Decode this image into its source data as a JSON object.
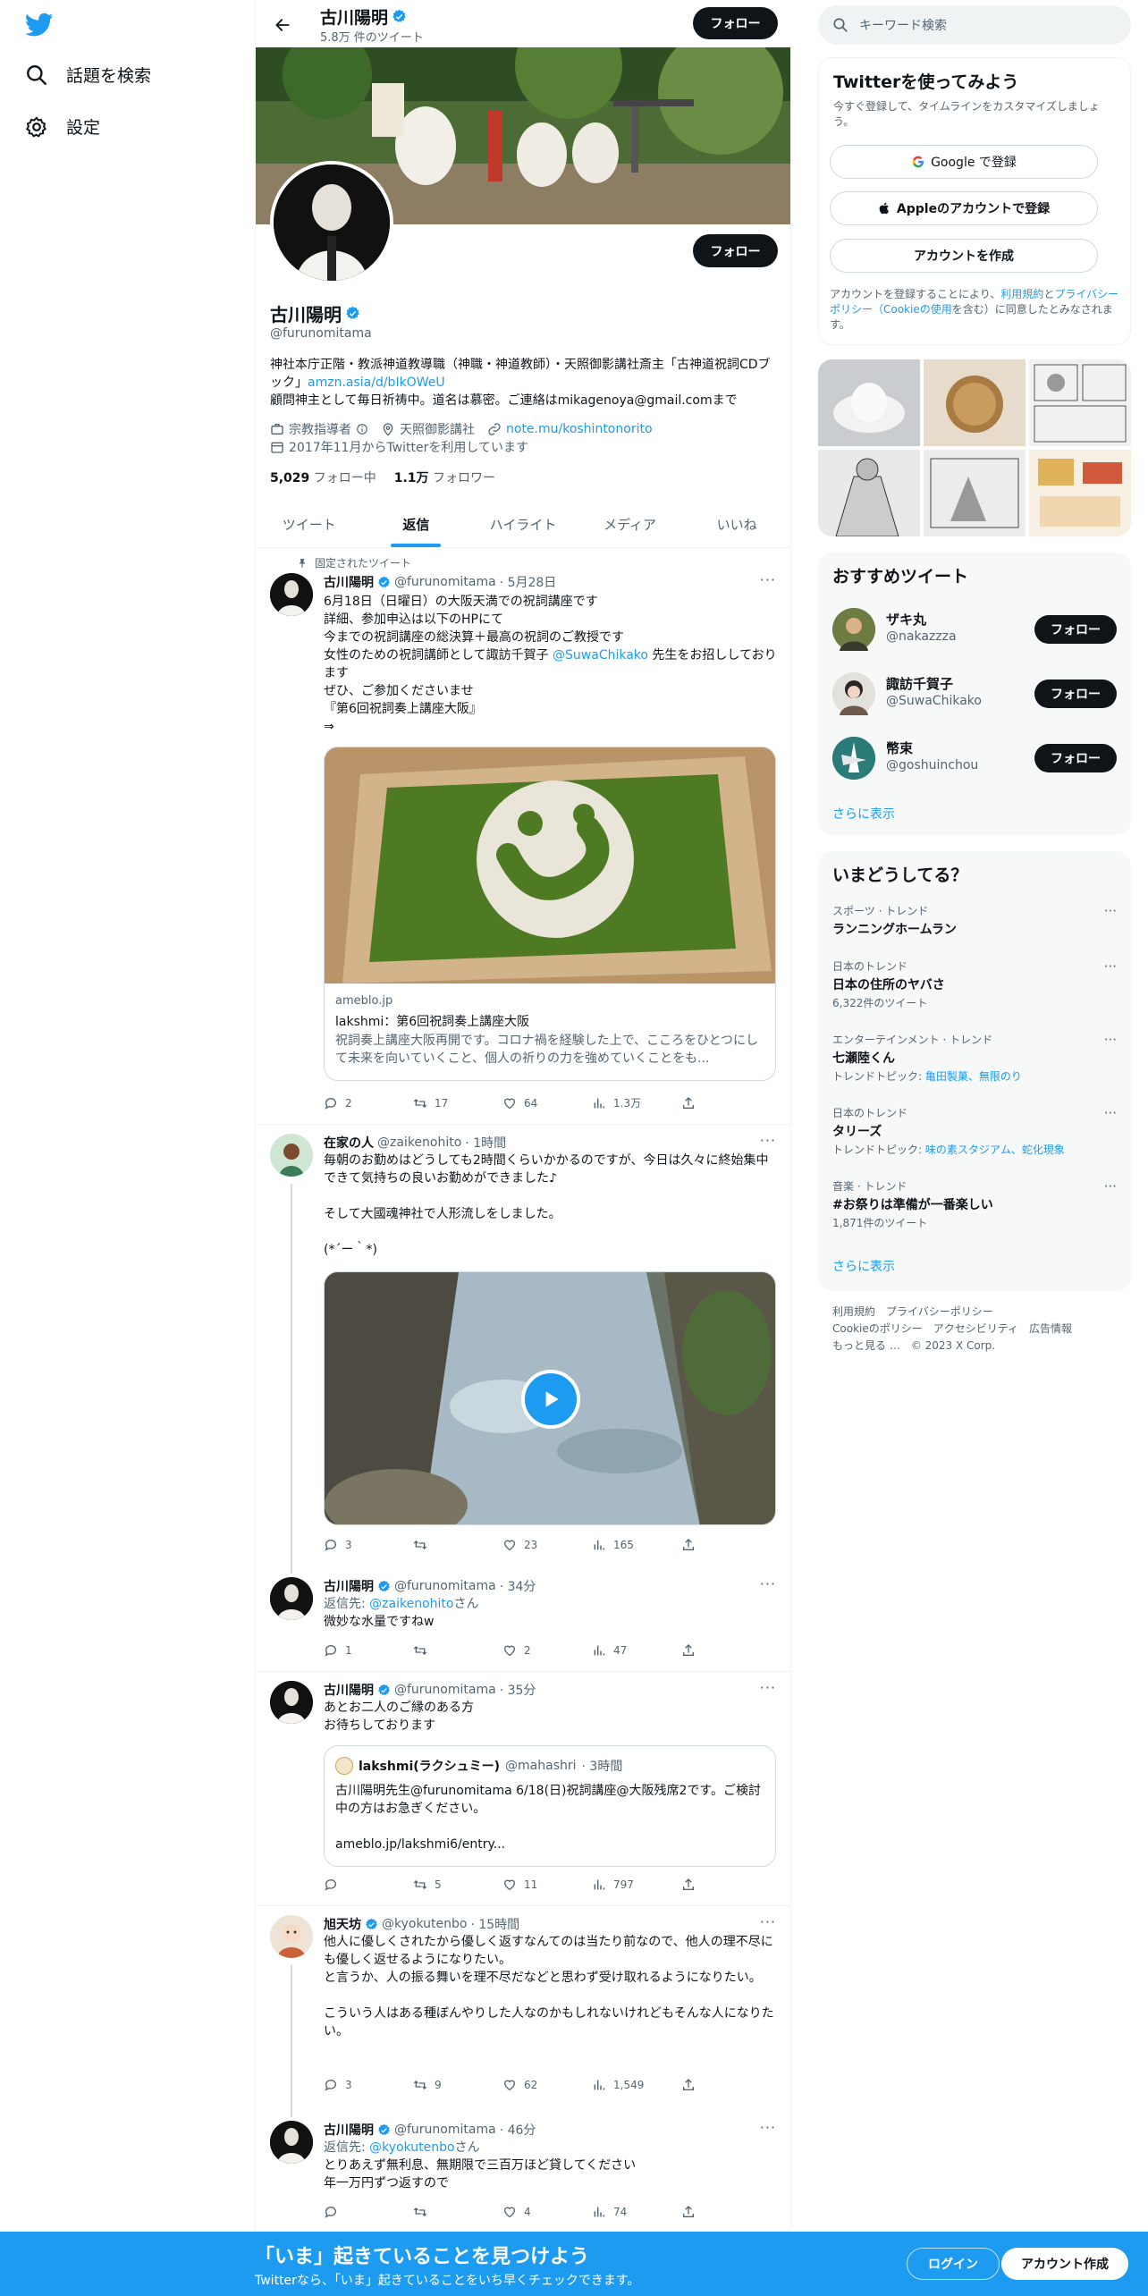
{
  "nav": {
    "explore": "話題を検索",
    "settings": "設定"
  },
  "header": {
    "name": "古川陽明",
    "tweet_count": "5.8万 件のツイート",
    "follow_label": "フォロー"
  },
  "profile": {
    "name": "古川陽明",
    "handle": "@furunomitama",
    "follow_label": "フォロー",
    "bio_line1": "神社本庁正階・教派神道教導職（神職・神道教師）・天照御影講社斎主「古神道祝詞CDブック」",
    "bio_link": "amzn.asia/d/bIkOWeU",
    "bio_line2": "顧問神主として毎日祈祷中。道名は慕密。ご連絡はmikagenoya@gmail.comまで",
    "category": "宗教指導者",
    "location": "天照御影講社",
    "website": "note.mu/koshintonorito",
    "joined": "2017年11月からTwitterを利用しています",
    "following_count": "5,029",
    "following_label": "フォロー中",
    "followers_count": "1.1万",
    "followers_label": "フォロワー"
  },
  "tabs": [
    "ツイート",
    "返信",
    "ハイライト",
    "メディア",
    "いいね"
  ],
  "tweets": {
    "pinned_label": "固定されたツイート",
    "t1": {
      "name": "古川陽明",
      "handle": "@furunomitama",
      "time": "· 5月28日",
      "text_a": "6月18日（日曜日）の大阪天満での祝詞講座です\n詳細、参加申込は以下のHPにて\n今までの祝詞講座の総決算＋最高の祝詞のご教授です\n女性のための祝詞講師として諏訪千賀子 ",
      "mention": "@SuwaChikako",
      "text_b": " 先生をお招ししております\nぜひ、ご参加くださいませ\n『第6回祝詞奏上講座大阪』\n⇒",
      "card_domain": "ameblo.jp",
      "card_title": "lakshmi：第6回祝詞奏上講座大阪",
      "card_desc": "祝詞奏上講座大阪再開です。コロナ禍を経験した上で、こころをひとつにして未来を向いていくこと、個人の祈りの力を強めていくことをも...",
      "replies": "2",
      "retweets": "17",
      "likes": "64",
      "views": "1.3万"
    },
    "t2": {
      "name": "在家の人",
      "handle": "@zaikenohito",
      "time": "· 1時間",
      "text": "毎朝のお勤めはどうしても2時間くらいかかるのですが、今日は久々に終始集中できて気持ちの良いお勤めができました♪\n\nそして大國魂神社で人形流しをしました。\n\n(*´ー｀*)",
      "replies": "3",
      "retweets": "",
      "likes": "23",
      "views": "165"
    },
    "t3": {
      "name": "古川陽明",
      "handle": "@furunomitama",
      "time": "· 34分",
      "reply_prefix": "返信先: ",
      "reply_to": "@zaikenohito",
      "reply_suffix": "さん",
      "text": "微妙な水量ですねw",
      "replies": "1",
      "retweets": "",
      "likes": "2",
      "views": "47"
    },
    "t4": {
      "name": "古川陽明",
      "handle": "@furunomitama",
      "time": "· 35分",
      "text": "あとお二人のご縁のある方\nお待ちしております",
      "quote_name": "lakshmi(ラクシュミー)",
      "quote_handle": "@mahashri",
      "quote_time": "· 3時間",
      "quote_text": "古川陽明先生@furunomitama 6/18(日)祝詞講座@大阪残席2です。ご検討中の方はお急ぎください。",
      "quote_link": "ameblo.jp/lakshmi6/entry...",
      "replies": "",
      "retweets": "5",
      "likes": "11",
      "views": "797"
    },
    "t5": {
      "name": "旭天坊",
      "handle": "@kyokutenbo",
      "time": "· 15時間",
      "text": "他人に優しくされたから優しく返すなんてのは当たり前なので、他人の理不尽にも優しく返せるようになりたい。\nと言うか、人の振る舞いを理不尽だなどと思わず受け取れるようになりたい。\n\nこういう人はある種ぼんやりした人なのかもしれないけれどもそんな人になりたい。",
      "replies": "3",
      "retweets": "9",
      "likes": "62",
      "views": "1,549"
    },
    "t6": {
      "name": "古川陽明",
      "handle": "@furunomitama",
      "time": "· 46分",
      "reply_prefix": "返信先: ",
      "reply_to": "@kyokutenbo",
      "reply_suffix": "さん",
      "text": "とりあえず無利息、無期限で三百万ほど貸してください\n年一万円ずつ返すので",
      "replies": "",
      "retweets": "",
      "likes": "4",
      "views": "74"
    }
  },
  "right": {
    "search_placeholder": "キーワード検索",
    "signup_title": "Twitterを使ってみよう",
    "signup_sub": "今すぐ登録して、タイムラインをカスタマイズしましょう。",
    "google_btn": "Google で登録",
    "apple_btn": "Appleのアカウントで登録",
    "create_btn": "アカウントを作成",
    "legal_a": "アカウントを登録することにより、",
    "legal_link1": "利用規約",
    "legal_b": "と",
    "legal_link2": "プライバシーポリシー（Cookieの使用",
    "legal_c": "を含む）に同意したとみなされます。",
    "recommend_title": "おすすめツイート",
    "recommend": [
      {
        "name": "ザキ丸",
        "handle": "@nakazzza",
        "button": "フォロー"
      },
      {
        "name": "諏訪千賀子",
        "handle": "@SuwaChikako",
        "button": "フォロー"
      },
      {
        "name": "幣束",
        "handle": "@goshuinchou",
        "button": "フォロー"
      }
    ],
    "show_more": "さらに表示",
    "trends_title": "いまどうしてる？",
    "trends": [
      {
        "cat": "スポーツ · トレンド",
        "name": "ランニングホームラン",
        "sub": "",
        "sub_links": ""
      },
      {
        "cat": "日本のトレンド",
        "name": "日本の住所のヤバさ",
        "sub": "6,322件のツイート",
        "sub_links": ""
      },
      {
        "cat": "エンターテインメント · トレンド",
        "name": "七瀬陸くん",
        "sub": "トレンドトピック: ",
        "sub_links": "亀田製菓、無限のり"
      },
      {
        "cat": "日本のトレンド",
        "name": "タリーズ",
        "sub": "トレンドトピック: ",
        "sub_links": "味の素スタジアム、蛇化現象"
      },
      {
        "cat": "音楽 · トレンド",
        "name": "#お祭りは準備が一番楽しい",
        "sub": "1,871件のツイート",
        "sub_links": ""
      }
    ],
    "trends_more": "さらに表示",
    "footer_line1": "利用規約　プライバシーポリシー",
    "footer_line2": "Cookieのポリシー　アクセシビリティ　広告情報",
    "footer_line3": "もっと見る …　© 2023 X Corp."
  },
  "bottom": {
    "title": "「いま」起きていることを見つけよう",
    "sub": "Twitterなら、「いま」起きていることをいち早くチェックできます。",
    "login": "ログイン",
    "signup": "アカウント作成"
  },
  "colors": {
    "accent": "#1d9bf0",
    "text": "#0f1419",
    "muted": "#536471"
  }
}
